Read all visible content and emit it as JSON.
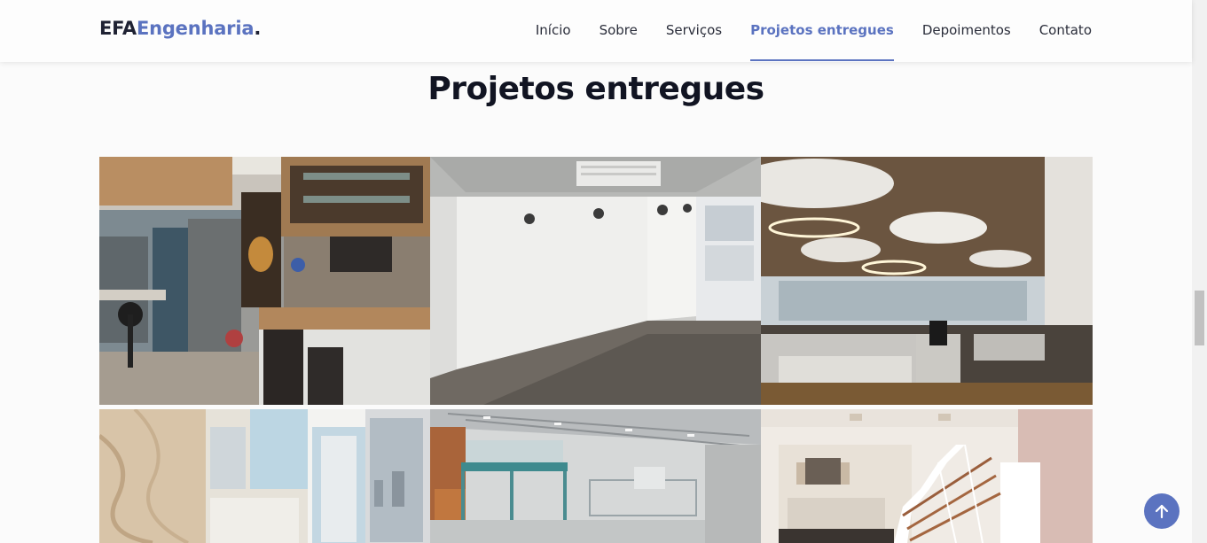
{
  "brand": {
    "logo_prefix": "EFA",
    "logo_accent": "Engenharia",
    "logo_suffix": ".",
    "accent_color": "#5b73c0"
  },
  "nav": {
    "items": [
      {
        "label": "Início",
        "active": false
      },
      {
        "label": "Sobre",
        "active": false
      },
      {
        "label": "Serviços",
        "active": false
      },
      {
        "label": "Projetos entregues",
        "active": true
      },
      {
        "label": "Depoimentos",
        "active": false
      },
      {
        "label": "Contato",
        "active": false
      }
    ]
  },
  "portfolio": {
    "title": "Projetos entregues",
    "projects": [
      {
        "subject": "apartment-kitchen-bar"
      },
      {
        "subject": "empty-gallery-room"
      },
      {
        "subject": "open-plan-office"
      },
      {
        "subject": "marble-bathroom"
      },
      {
        "subject": "warehouse-mezzanine"
      },
      {
        "subject": "loft-staircase-kitchen"
      }
    ]
  },
  "back_to_top": {
    "icon": "arrow-up-icon"
  }
}
